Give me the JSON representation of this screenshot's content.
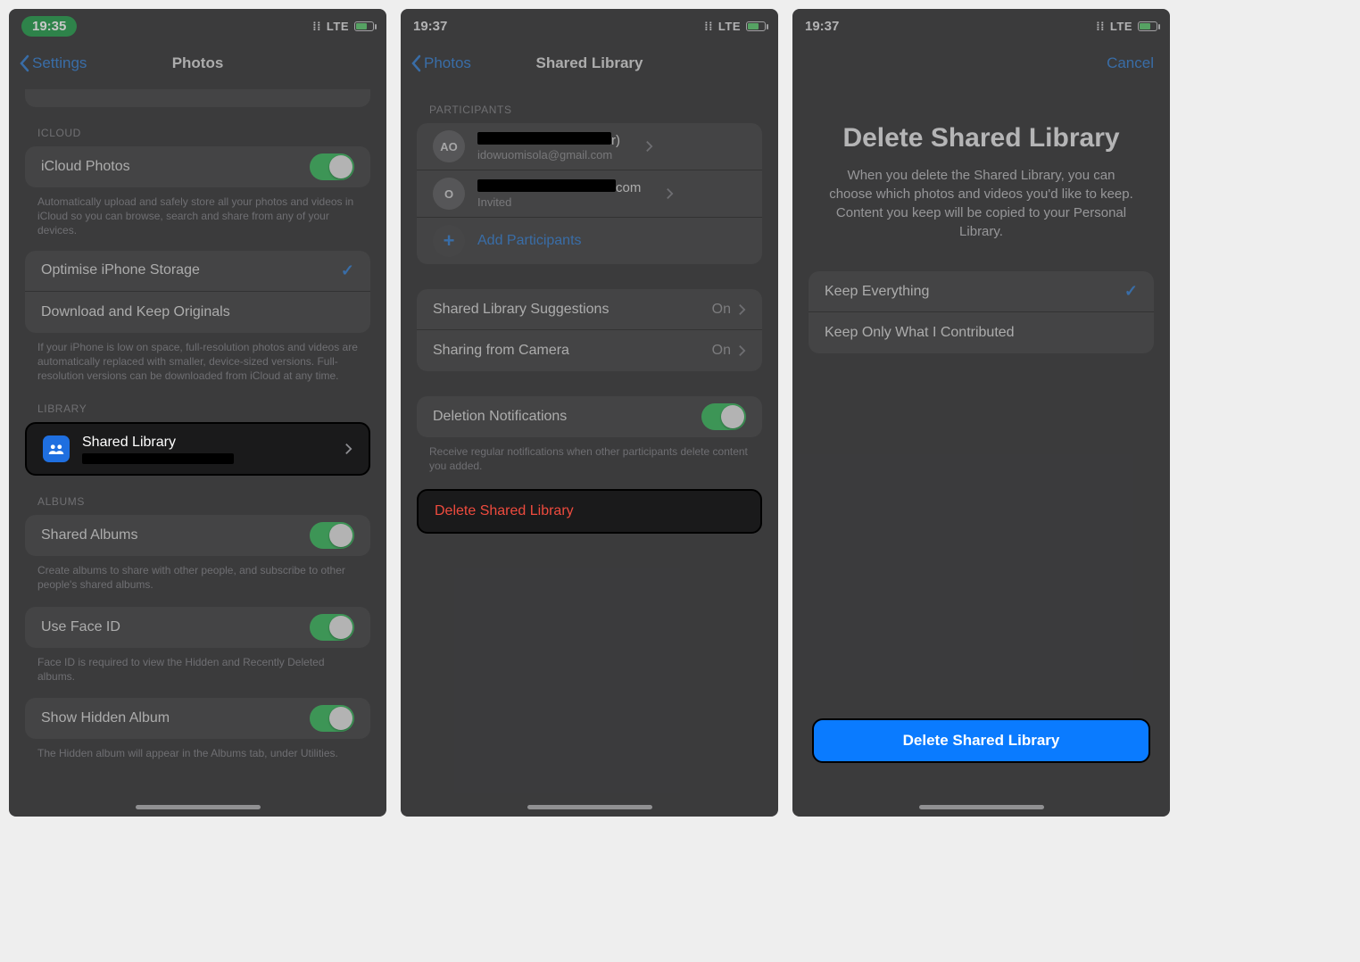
{
  "screen1": {
    "status_time": "19:35",
    "status_net": "LTE",
    "back_label": "Settings",
    "title": "Photos",
    "icloud_header": "ICLOUD",
    "icloud_photos": "iCloud Photos",
    "icloud_desc": "Automatically upload and safely store all your photos and videos in iCloud so you can browse, search and share from any of your devices.",
    "optimise": "Optimise iPhone Storage",
    "download": "Download and Keep Originals",
    "storage_desc": "If your iPhone is low on space, full-resolution photos and videos are automatically replaced with smaller, device-sized versions. Full-resolution versions can be downloaded from iCloud at any time.",
    "library_header": "LIBRARY",
    "shared_library": "Shared Library",
    "albums_header": "ALBUMS",
    "shared_albums": "Shared Albums",
    "shared_albums_desc": "Create albums to share with other people, and subscribe to other people's shared albums.",
    "face_id": "Use Face ID",
    "face_id_desc": "Face ID is required to view the Hidden and Recently Deleted albums.",
    "hidden": "Show Hidden Album",
    "hidden_desc": "The Hidden album will appear in the Albums tab, under Utilities."
  },
  "screen2": {
    "status_time": "19:37",
    "status_net": "LTE",
    "back_label": "Photos",
    "title": "Shared Library",
    "participants_header": "PARTICIPANTS",
    "p1_initials": "AO",
    "p1_name_suffix": "r)",
    "p1_email": "idowuomisola@gmail.com",
    "p2_initials": "O",
    "p2_name_suffix": "com",
    "p2_status": "Invited",
    "add_participants": "Add Participants",
    "suggestions": "Shared Library Suggestions",
    "suggestions_val": "On",
    "camera": "Sharing from Camera",
    "camera_val": "On",
    "deletion": "Deletion Notifications",
    "deletion_desc": "Receive regular notifications when other participants delete content you added.",
    "delete_btn": "Delete Shared Library"
  },
  "screen3": {
    "status_time": "19:37",
    "status_net": "LTE",
    "cancel": "Cancel",
    "title": "Delete Shared Library",
    "body": "When you delete the Shared Library, you can choose which photos and videos you'd like to keep. Content you keep will be copied to your Personal Library.",
    "keep_all": "Keep Everything",
    "keep_mine": "Keep Only What I Contributed",
    "delete_cta": "Delete Shared Library"
  }
}
